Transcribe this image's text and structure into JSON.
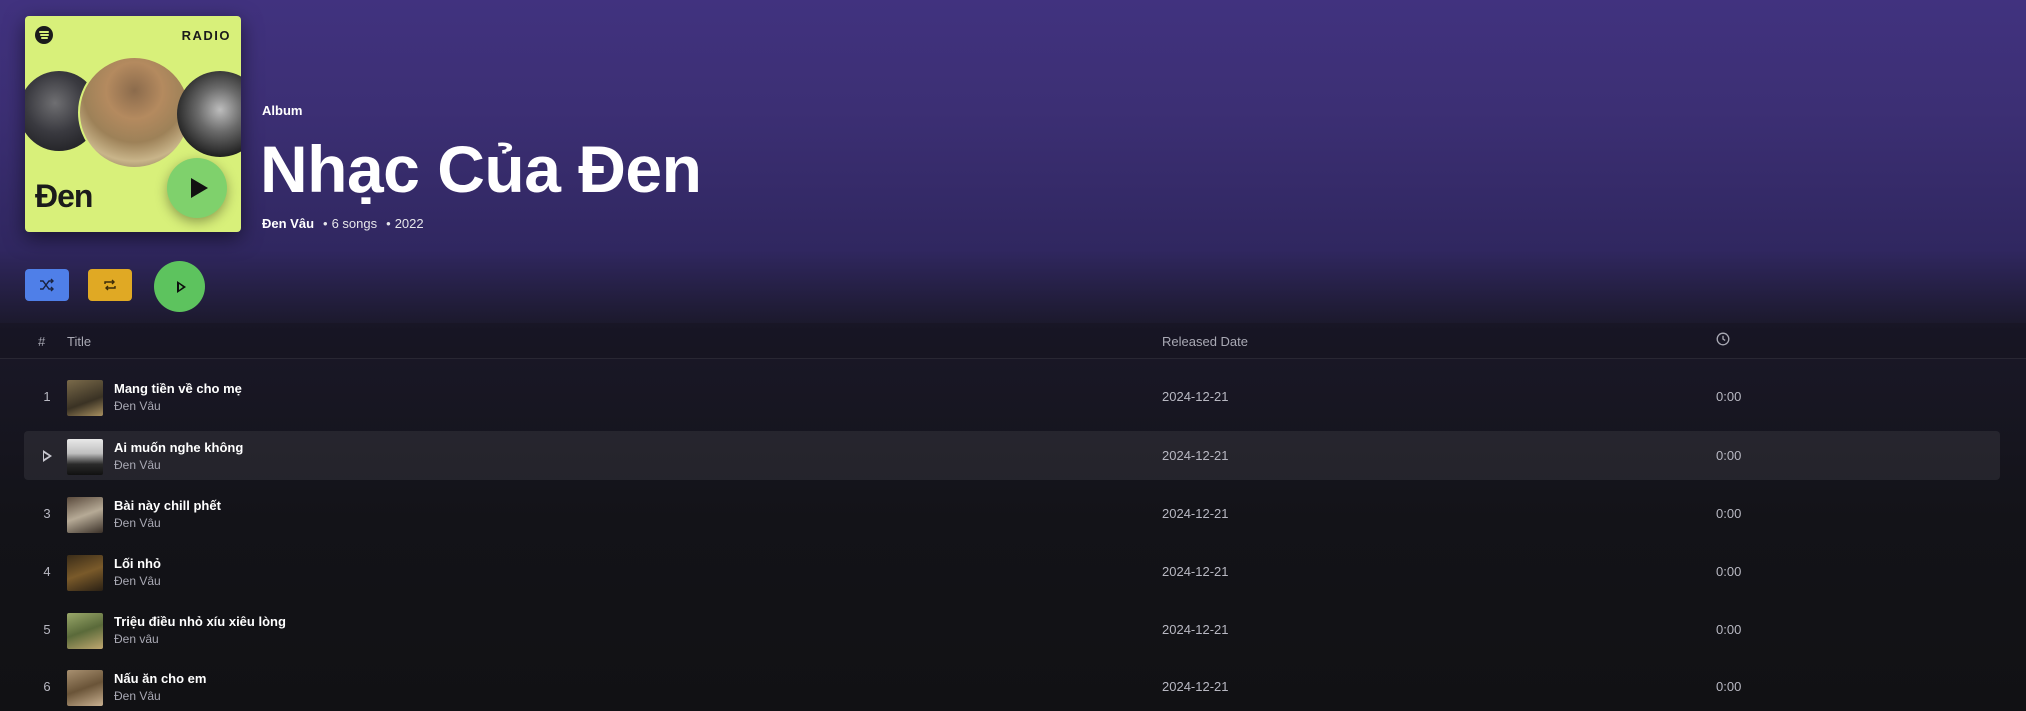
{
  "album": {
    "cover": {
      "badge": "RADIO",
      "artist_word": "Đen",
      "background_color": "#d8f07a"
    },
    "type_label": "Album",
    "title": "Nhạc Của Đen",
    "artist": "Đen Vâu",
    "song_count": "6 songs",
    "year": "2022"
  },
  "controls": {
    "shuffle_icon": "shuffle-icon",
    "repeat_icon": "repeat-icon",
    "play_icon": "play-icon",
    "colors": {
      "shuffle": "#4f7fe8",
      "repeat": "#e0a924",
      "play": "#5dc35e"
    }
  },
  "table": {
    "headers": {
      "number": "#",
      "title": "Title",
      "released": "Released Date",
      "duration_icon": "clock-icon"
    },
    "rows": [
      {
        "number": "1",
        "title": "Mang tiền về cho mẹ",
        "artist": "Đen Vâu",
        "released": "2024-12-21",
        "duration": "0:00"
      },
      {
        "number": "2",
        "title": "Ai muốn nghe không",
        "artist": "Đen Vâu",
        "released": "2024-12-21",
        "duration": "0:00",
        "hovered": true
      },
      {
        "number": "3",
        "title": "Bài này chill phết",
        "artist": "Đen Vâu",
        "released": "2024-12-21",
        "duration": "0:00"
      },
      {
        "number": "4",
        "title": "Lối nhỏ",
        "artist": "Đen Vâu",
        "released": "2024-12-21",
        "duration": "0:00"
      },
      {
        "number": "5",
        "title": "Triệu điều nhỏ xíu xiêu lòng",
        "artist": "Đen vâu",
        "released": "2024-12-21",
        "duration": "0:00"
      },
      {
        "number": "6",
        "title": "Nấu ăn cho em",
        "artist": "Đen Vâu",
        "released": "2024-12-21",
        "duration": "0:00"
      }
    ]
  }
}
